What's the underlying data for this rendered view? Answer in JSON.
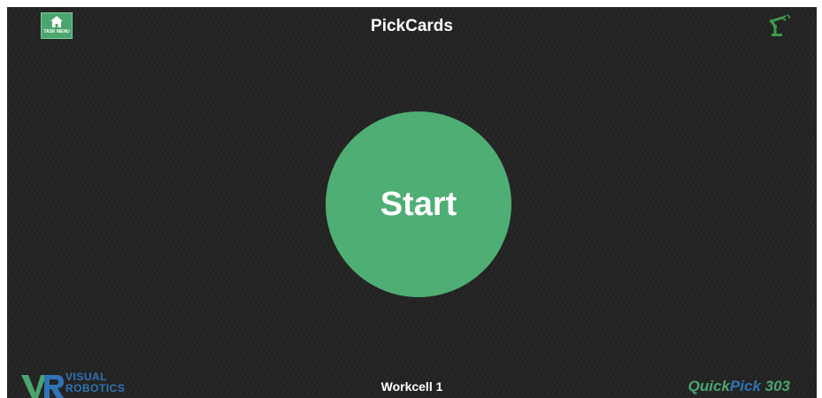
{
  "header": {
    "title": "PickCards",
    "task_menu_label": "TASK MENU",
    "home_icon": "home-icon",
    "robot_icon": "robot-arm-icon"
  },
  "main": {
    "start_label": "Start"
  },
  "footer": {
    "logo_line1": "VISUAL",
    "logo_line2": "ROBOTICS",
    "logo_mark": "VR",
    "workcell": "Workcell 1",
    "product_part1": "Quick",
    "product_part2": "Pick",
    "product_part3": " 303"
  },
  "colors": {
    "background": "#232323",
    "accent_green": "#4fae74",
    "brand_blue": "#2f74b5",
    "text": "#ffffff"
  }
}
